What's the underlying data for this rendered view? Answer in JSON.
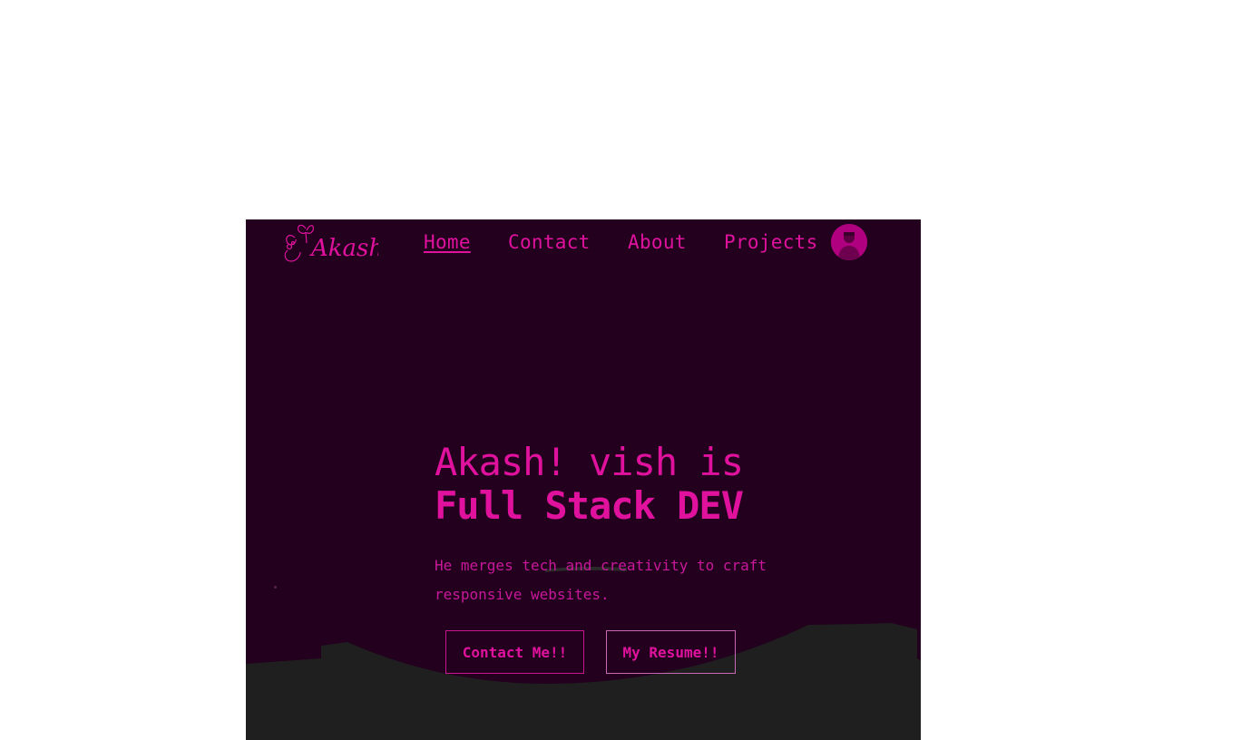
{
  "logo": {
    "text": "Akash"
  },
  "nav": {
    "items": [
      {
        "label": "Home",
        "active": true
      },
      {
        "label": "Contact",
        "active": false
      },
      {
        "label": "About",
        "active": false
      },
      {
        "label": "Projects",
        "active": false
      }
    ]
  },
  "hero": {
    "line1": "Akash! vish is",
    "line2": "Full Stack DEV",
    "description": "He merges tech and creativity to craft responsive websites."
  },
  "buttons": {
    "contact": "Contact Me!!",
    "resume": "My Resume!!"
  },
  "colors": {
    "background": "#22001e",
    "accent": "#e0129d",
    "ground": "#1f1f1f",
    "page": "#ffffff"
  }
}
